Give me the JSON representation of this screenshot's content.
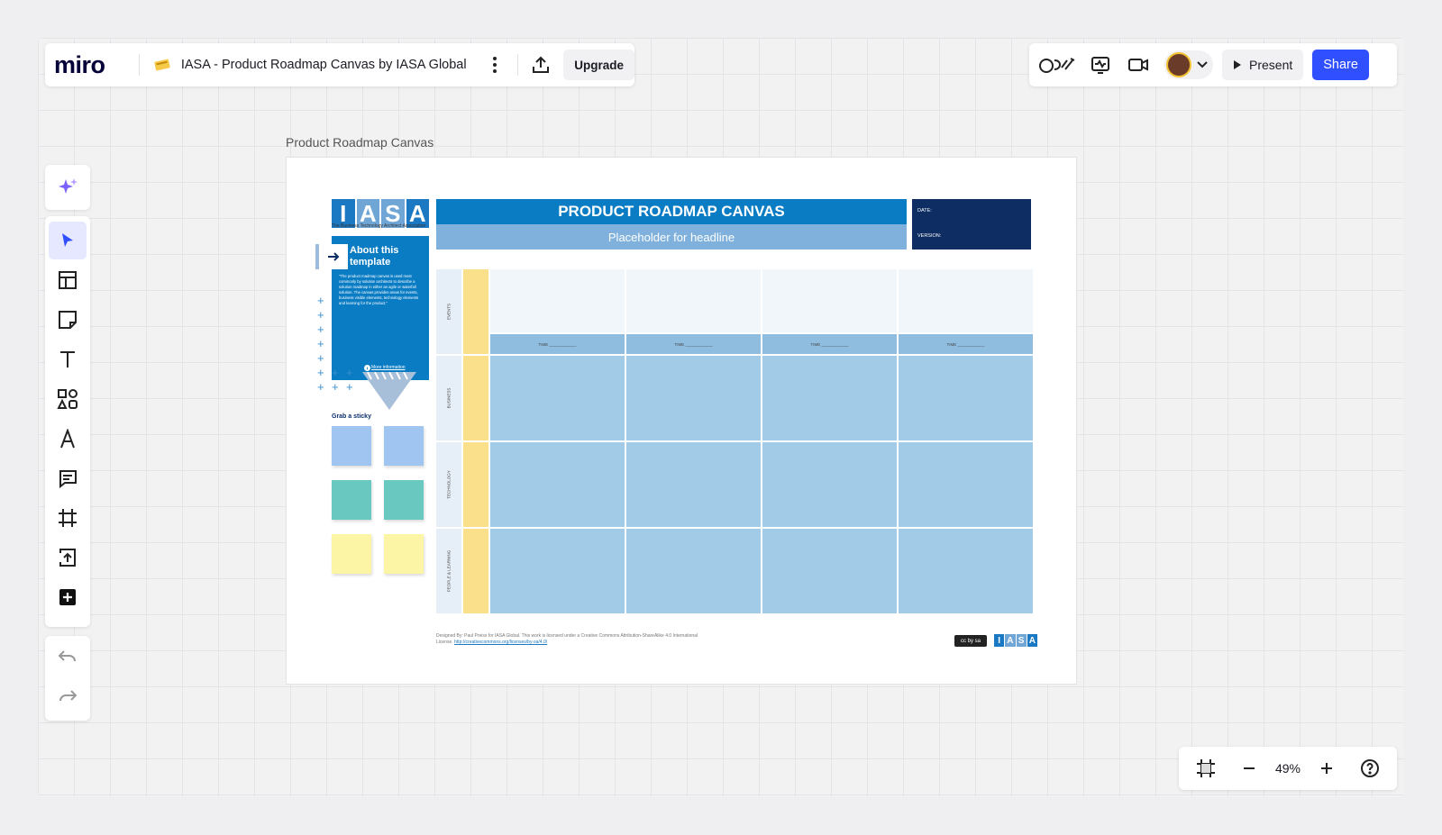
{
  "header": {
    "logo": "miro",
    "board_title": "IASA - Product Roadmap Canvas by IASA Global",
    "upgrade_label": "Upgrade",
    "present_label": "Present",
    "share_label": "Share"
  },
  "zoom": {
    "level": "49%"
  },
  "frame": {
    "label": "Product Roadmap Canvas",
    "logo_letters": [
      "I",
      "A",
      "S",
      "A"
    ],
    "logo_subtitle": "The Business Technology Architect Association",
    "title": "PRODUCT ROADMAP CANVAS",
    "subtitle": "Placeholder for headline",
    "date_label": "DATE:",
    "version_label": "VERSION:",
    "about_title": "About this template",
    "about_text": "\"The product roadmap canvas is used most commonly by solution architects to describe a solution roadmap in either an agile or waterfall solution. The canvas provides areas for events, business visible elements, technology elements and learning for the product.\"",
    "about_link": "More information",
    "grab_sticky": "Grab a sticky",
    "rows": [
      "EVENTS",
      "BUSINESS",
      "TECHNOLOGY",
      "PEOPLE & LEARNING"
    ],
    "time_label": "TIME ____________",
    "footer_text": "Designed By: Paul Preiss for IASA Global. This work is licensed under a Creative Commons Attribution-ShareAlike 4.0 International License.",
    "footer_link": "http://creativecommons.org/licenses/by-sa/4.0/",
    "cc_badge": "cc by sa"
  },
  "colors": {
    "accent": "#3050ff",
    "iasa_blue": "#0a7cc4",
    "navy": "#0d2d63",
    "cell_blue": "#a2cbe7",
    "yellow": "#fbe08c"
  }
}
